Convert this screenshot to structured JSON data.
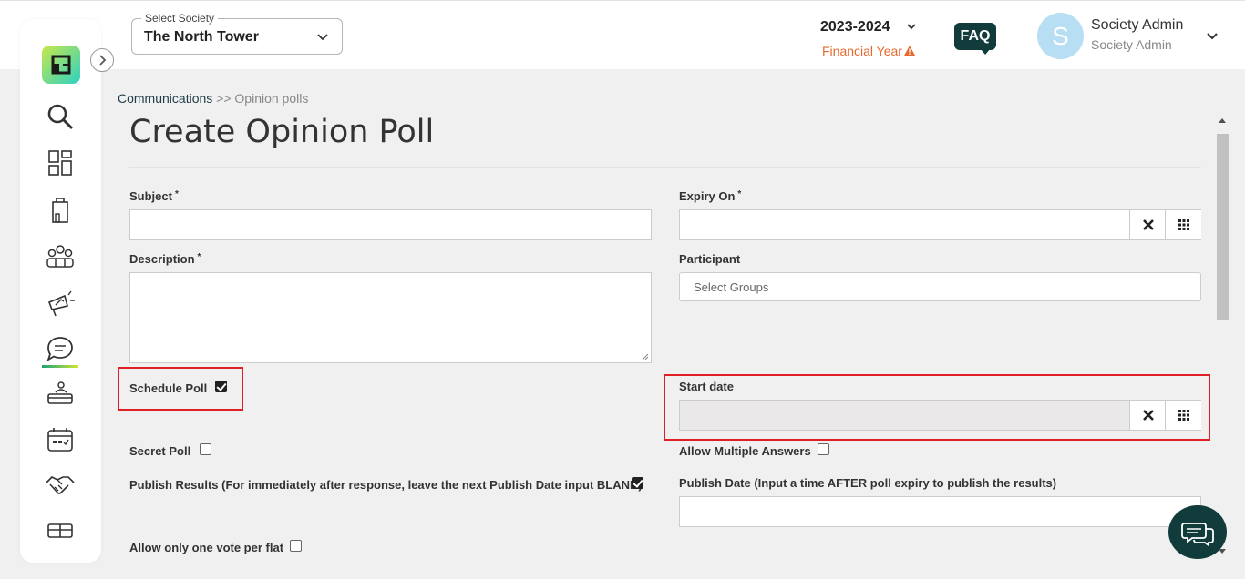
{
  "header": {
    "society_legend": "Select Society",
    "society_value": "The North Tower",
    "financial_year": "2023-2024",
    "financial_year_label": "Financial Year",
    "faq_label": "FAQ",
    "avatar_letter": "S",
    "user_name": "Society Admin",
    "user_role": "Society Admin"
  },
  "sidebar": {
    "logo_text": "aR",
    "items": [
      "search-icon",
      "dashboard-icon",
      "building-icon",
      "members-icon",
      "announcement-icon",
      "communications-icon",
      "helpdesk-icon",
      "calendar-icon",
      "partners-icon",
      "inventory-icon"
    ]
  },
  "breadcrumb": {
    "parent": "Communications",
    "separator": ">>",
    "current": "Opinion polls"
  },
  "page": {
    "title": "Create Opinion Poll"
  },
  "form": {
    "subject_label": "Subject",
    "expiry_label": "Expiry On",
    "description_label": "Description",
    "participant_label": "Participant",
    "participant_placeholder": "Select Groups",
    "required_mark": "*",
    "schedule_poll_label": "Schedule Poll",
    "schedule_poll_checked": true,
    "start_date_label": "Start date",
    "secret_poll_label": "Secret Poll",
    "secret_poll_checked": false,
    "allow_multiple_label": "Allow Multiple Answers",
    "allow_multiple_checked": false,
    "publish_results_label": "Publish Results (For immediately after response, leave the next Publish Date input BLANK)",
    "publish_results_checked": true,
    "publish_date_label": "Publish Date (Input a time AFTER poll expiry to publish the results)",
    "one_vote_label": "Allow only one vote per flat",
    "one_vote_checked": false
  },
  "colors": {
    "brand_dark": "#123c3c",
    "highlight_red": "#e01e25",
    "warning_orange": "#e8692e"
  }
}
